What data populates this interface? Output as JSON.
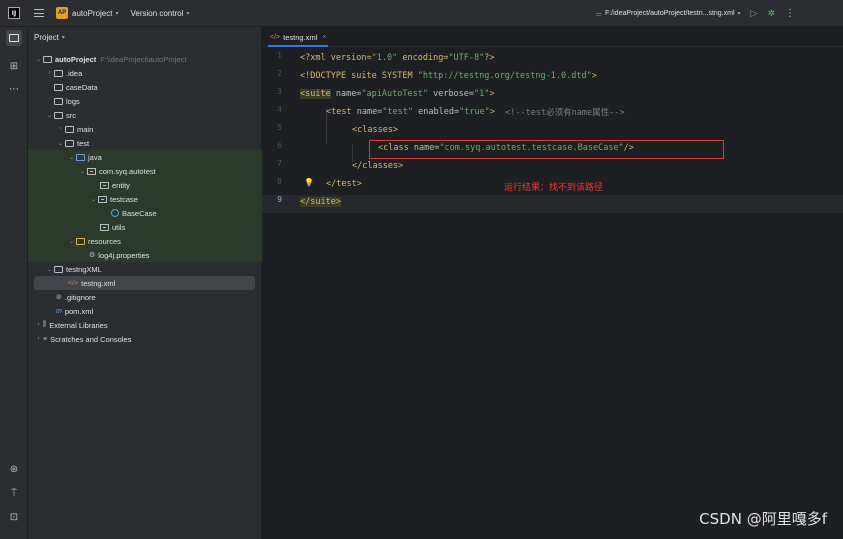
{
  "titlebar": {
    "logo": "IJ",
    "project_badge": "AP",
    "project_name": "autoProject",
    "version_control": "Version control",
    "file_path": "F:/ideaProject/autoProject/testn...stng.xml"
  },
  "project_panel": {
    "header": "Project",
    "root_name": "autoProject",
    "root_path": "F:\\ideaProject\\autoProject",
    "items": [
      {
        "label": ".idea"
      },
      {
        "label": "caseData"
      },
      {
        "label": "logs"
      },
      {
        "label": "src"
      },
      {
        "label": "main"
      },
      {
        "label": "test"
      },
      {
        "label": "java"
      },
      {
        "label": "com.syq.autotest"
      },
      {
        "label": "entity"
      },
      {
        "label": "testcase"
      },
      {
        "label": "BaseCase"
      },
      {
        "label": "utils"
      },
      {
        "label": "resources"
      },
      {
        "label": "log4j.properties"
      },
      {
        "label": "testngXML"
      },
      {
        "label": "testng.xml"
      },
      {
        "label": ".gitignore"
      },
      {
        "label": "pom.xml"
      },
      {
        "label": "External Libraries"
      },
      {
        "label": "Scratches and Consoles"
      }
    ]
  },
  "editor": {
    "tab_label": "testng.xml",
    "line_numbers": [
      "1",
      "2",
      "3",
      "4",
      "5",
      "6",
      "7",
      "8",
      "9"
    ],
    "lines": {
      "l1_a": "<?xml version=",
      "l1_b": "\"1.0\"",
      "l1_c": " encoding=",
      "l1_d": "\"UTF-8\"",
      "l1_e": "?>",
      "l2_a": "<!DOCTYPE suite SYSTEM ",
      "l2_b": "\"http://testng.org/testng-1.0.dtd\"",
      "l2_c": ">",
      "l3_a": "<suite",
      "l3_b": " name=",
      "l3_c": "\"apiAutoTest\"",
      "l3_d": " verbose=",
      "l3_e": "\"1\"",
      "l3_f": ">",
      "l4_a": "<test",
      "l4_b": " name=",
      "l4_c": "\"test\"",
      "l4_d": " enabled=",
      "l4_e": "\"true\"",
      "l4_f": ">",
      "l4_g": "  <!--test必须有name属性-->",
      "l5": "<classes>",
      "l6_a": "<class",
      "l6_b": " name=",
      "l6_c": "\"com.syq.autotest.testcase.BaseCase\"",
      "l6_d": "/>",
      "l7": "</classes>",
      "l8": "</test>",
      "l9": "</suite>"
    },
    "annotation": "运行结果：找不到该路径"
  },
  "watermark": "CSDN @阿里嘎多f",
  "colors": {
    "accent": "#3574f0",
    "annotation_red": "#e8392c",
    "xml_tag": "#d5b778",
    "xml_value": "#6aab73"
  }
}
